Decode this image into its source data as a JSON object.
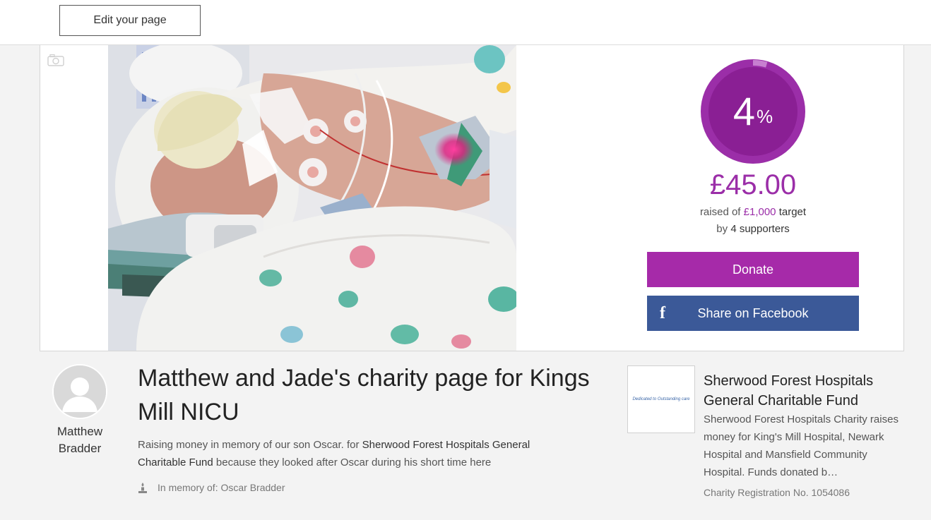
{
  "topbar": {
    "edit_label": "Edit your page"
  },
  "fundraising": {
    "percent": "4",
    "percent_symbol": "%",
    "progress_fraction": 0.045,
    "raised": "£45.00",
    "raised_prefix": "raised of ",
    "target": "£1,000",
    "target_suffix": " target",
    "supporters_prefix": "by ",
    "supporters": "4 supporters",
    "donate_label": "Donate",
    "facebook_label": "Share on Facebook",
    "facebook_icon": "f"
  },
  "owner": {
    "name_first": "Matthew",
    "name_last": "Bradder"
  },
  "page": {
    "title": "Matthew and Jade's charity page for Kings Mill NICU",
    "desc_start": "Raising money in memory of our son Oscar. for ",
    "desc_charity": "Sherwood Forest Hospitals General Charitable Fund",
    "desc_end": " because they looked after Oscar during his short time here",
    "memory": "In memory of: Oscar Bradder"
  },
  "charity": {
    "logo_text": "Dedicated to Outstanding care",
    "name": "Sherwood Forest Hospitals General Charitable Fund",
    "description": "Sherwood Forest Hospitals Charity raises money for King's Mill Hospital, Newark Hospital and Mansfield Community Hospital. Funds donated b…",
    "registration": "Charity Registration No. 1054086"
  },
  "colors": {
    "accent": "#a62aa9",
    "ring_fill": "#8a1f94",
    "facebook": "#3b5998"
  },
  "icons": {
    "camera": "camera-icon",
    "facebook": "facebook-icon",
    "memory": "memorial-candle-icon",
    "avatar": "user-avatar-icon"
  }
}
